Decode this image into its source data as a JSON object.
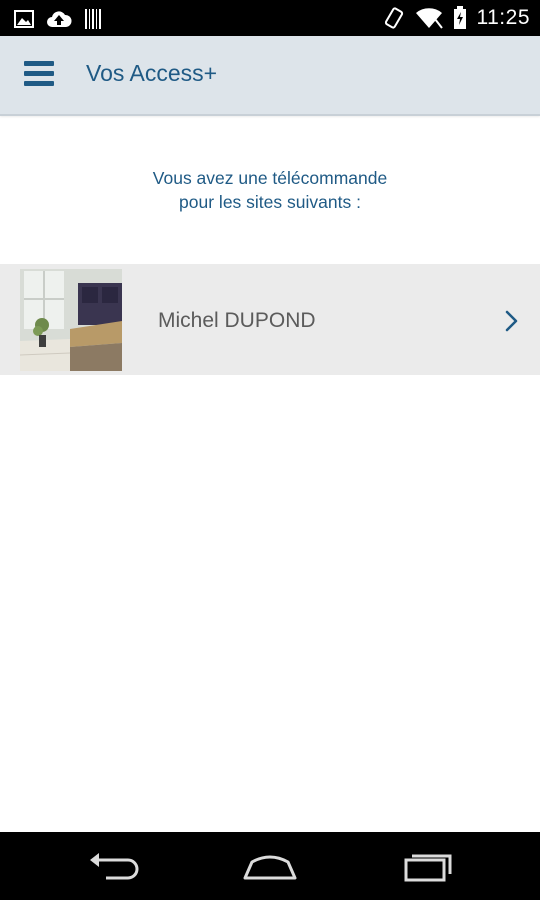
{
  "status_bar": {
    "time": "11:25",
    "left_icons": [
      "image-icon",
      "cloud-upload-icon",
      "barcode-icon"
    ],
    "right_icons": [
      "screen-rotation-icon",
      "wifi-icon",
      "battery-icon"
    ]
  },
  "app_bar": {
    "title": "Vos Access+",
    "menu_icon": "hamburger-menu-icon",
    "accent_color": "#1f5a85",
    "background_color": "#dde4ea"
  },
  "intro": {
    "line1": "Vous avez une télécommande",
    "line2": "pour les sites suivants :"
  },
  "sites": [
    {
      "name": "Michel DUPOND",
      "thumbnail": "kitchen-interior-photo",
      "chevron_icon": "chevron-right-icon"
    }
  ],
  "nav_bar": {
    "back_icon": "back-icon",
    "home_icon": "home-icon",
    "recents_icon": "recent-apps-icon"
  }
}
